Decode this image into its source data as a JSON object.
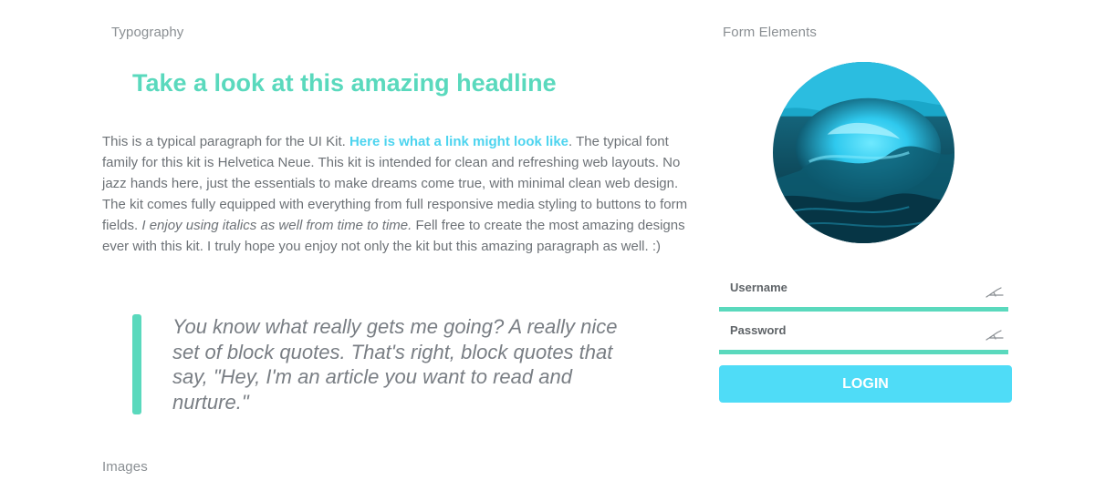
{
  "sections": {
    "typography": "Typography",
    "form_elements": "Form Elements",
    "images": "Images"
  },
  "typography": {
    "headline": "Take a look at this amazing headline",
    "paragraph": {
      "part1": "This is a typical paragraph for the UI Kit. ",
      "link": "Here is what a link might look like",
      "part2": ". The typical font family for this kit is Helvetica Neue. This kit is intended for clean and refreshing web layouts. No jazz hands here, just the essentials to make dreams come true, with minimal clean web design. The kit comes fully equipped with everything from full responsive media styling to buttons to form fields. ",
      "italic": "I enjoy using italics as well from time to time.",
      "part3": " Fell free to create the most amazing designs ever with this kit. I truly hope you enjoy not only the kit but this amazing paragraph as well. :)"
    },
    "blockquote": "You know what really gets me going? A really nice set of block quotes. That's right, block quotes that say, \"Hey, I'm an article you want to read and nurture.\""
  },
  "form": {
    "username_label": "Username",
    "password_label": "Password",
    "username_icon": "pen-icon",
    "password_icon": "pen-icon",
    "login_label": "LOGIN"
  },
  "colors": {
    "accent_green": "#5ad9bd",
    "accent_blue": "#4fdcf7",
    "text": "#6d7277"
  }
}
